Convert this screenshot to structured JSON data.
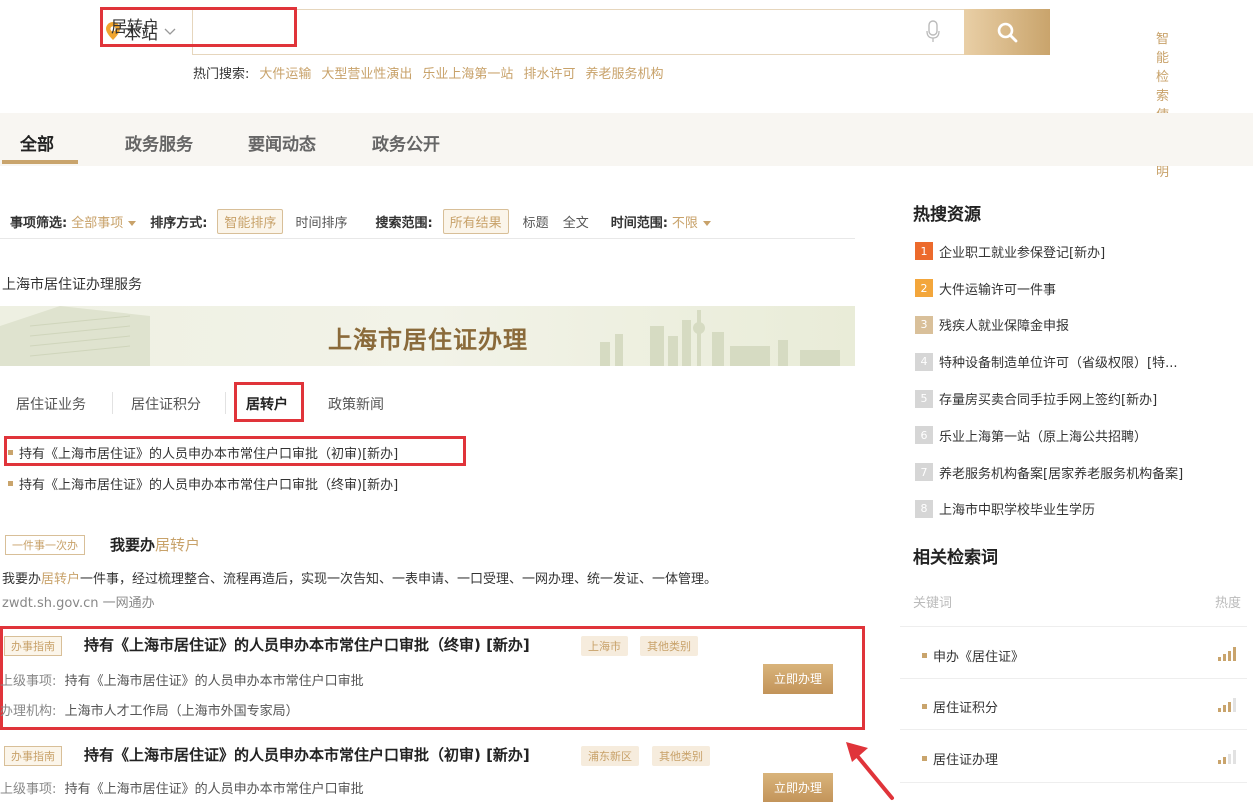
{
  "search": {
    "site_label": "本站",
    "query": "居转户",
    "button_label": "",
    "help_link": "智能检索使用说明",
    "hot_label": "热门搜索:",
    "hot_items": [
      "大件运输",
      "大型营业性演出",
      "乐业上海第一站",
      "排水许可",
      "养老服务机构"
    ]
  },
  "tabs": [
    "全部",
    "政务服务",
    "要闻动态",
    "政务公开"
  ],
  "filters": {
    "item_filter_label": "事项筛选:",
    "item_filter_value": "全部事项",
    "sort_label": "排序方式:",
    "sort_active": "智能排序",
    "sort_other": "时间排序",
    "scope_label": "搜索范围:",
    "scope_active": "所有结果",
    "scope_title": "标题",
    "scope_full": "全文",
    "time_label": "时间范围:",
    "time_value": "不限"
  },
  "service": {
    "section_title": "上海市居住证办理服务",
    "banner_title": "上海市居住证办理",
    "subtabs": [
      "居住证业务",
      "居住证积分",
      "居转户",
      "政策新闻"
    ],
    "items": [
      "持有《上海市居住证》的人员申办本市常住户口审批（初审)[新办]",
      "持有《上海市居住证》的人员申办本市常住户口审批（终审)[新办]"
    ]
  },
  "one_thing": {
    "tag": "一件事一次办",
    "title_prefix": "我要办",
    "title_keyword": "居转户",
    "desc_prefix": "我要办",
    "desc_keyword": "居转户",
    "desc_rest": "一件事，经过梳理整合、流程再造后，实现一次告知、一表申请、一口受理、一网办理、统一发证、一体管理。",
    "source": "zwdt.sh.gov.cn    一网通办"
  },
  "guides": [
    {
      "tag": "办事指南",
      "title": "持有《上海市居住证》的人员申办本市常住户口审批（终审) [新办]",
      "badges": [
        "上海市",
        "其他类别"
      ],
      "parent_label": "上级事项:",
      "parent_value": "持有《上海市居住证》的人员申办本市常住户口审批",
      "org_label": "办理机构:",
      "org_value": "上海市人才工作局（上海市外国专家局）",
      "button": "立即办理"
    },
    {
      "tag": "办事指南",
      "title": "持有《上海市居住证》的人员申办本市常住户口审批（初审) [新办]",
      "badges": [
        "浦东新区",
        "其他类别"
      ],
      "parent_label": "上级事项:",
      "parent_value": "持有《上海市居住证》的人员申办本市常住户口审批",
      "button": "立即办理"
    }
  ],
  "hot_resources": {
    "title": "热搜资源",
    "items": [
      {
        "rank": "1",
        "label": "企业职工就业参保登记[新办]"
      },
      {
        "rank": "2",
        "label": "大件运输许可一件事"
      },
      {
        "rank": "3",
        "label": "残疾人就业保障金申报"
      },
      {
        "rank": "4",
        "label": "特种设备制造单位许可（省级权限）[特..."
      },
      {
        "rank": "5",
        "label": "存量房买卖合同手拉手网上签约[新办]"
      },
      {
        "rank": "6",
        "label": "乐业上海第一站（原上海公共招聘）"
      },
      {
        "rank": "7",
        "label": "养老服务机构备案[居家养老服务机构备案]"
      },
      {
        "rank": "8",
        "label": "上海市中职学校毕业生学历"
      }
    ]
  },
  "related": {
    "title": "相关检索词",
    "col_keyword": "关键词",
    "col_heat": "热度",
    "items": [
      "申办《居住证》",
      "居住证积分",
      "居住证办理"
    ]
  },
  "colors": {
    "accent_gold": "#c8a26a",
    "highlight_red": "#e0343a",
    "rank1": "#ec6a2c",
    "rank2": "#f3a63b"
  }
}
